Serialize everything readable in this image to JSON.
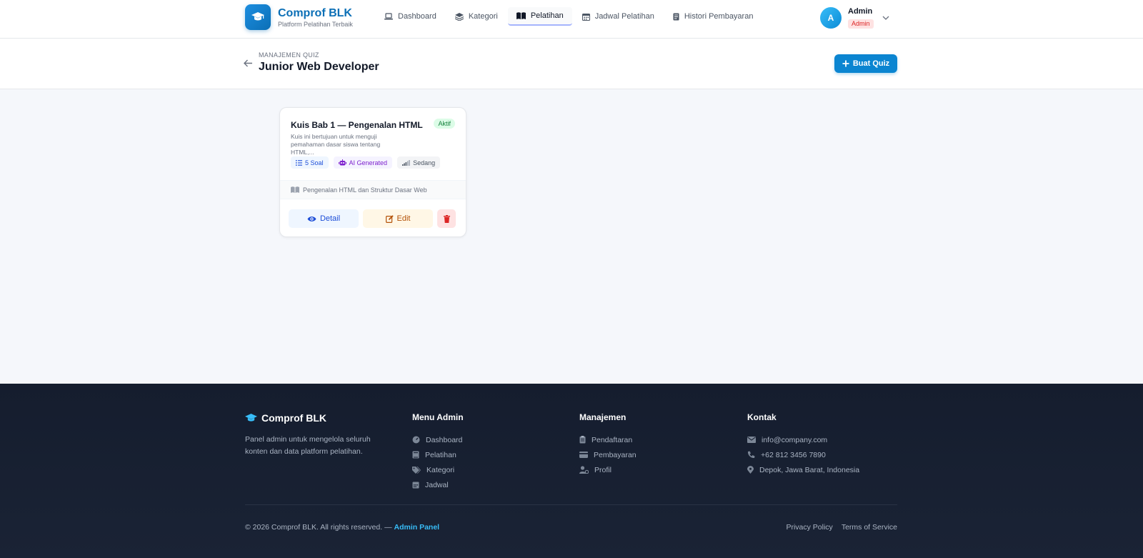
{
  "brand": {
    "title": "Comprof BLK",
    "subtitle": "Platform Pelatihan Terbaik",
    "color": "#0b6fb6"
  },
  "nav": {
    "items": [
      {
        "label": "Dashboard",
        "icon": "laptop-icon"
      },
      {
        "label": "Kategori",
        "icon": "layers-icon"
      },
      {
        "label": "Pelatihan",
        "icon": "book-open-icon",
        "active": true
      },
      {
        "label": "Jadwal Pelatihan",
        "icon": "calendar-icon"
      },
      {
        "label": "Histori Pembayaran",
        "icon": "receipt-icon"
      }
    ]
  },
  "user": {
    "initial": "A",
    "name": "Admin",
    "role": "Admin"
  },
  "header": {
    "breadcrumb": "MANAJEMEN QUIZ",
    "title": "Junior Web Developer",
    "create_button": "Buat Quiz"
  },
  "quiz_card": {
    "title": "Kuis Bab 1 — Pengenalan HTML",
    "status": "Aktif",
    "description": "Kuis ini bertujuan untuk menguji pemahaman dasar siswa tentang HTML,...",
    "question_count": "5 Soal",
    "generator": "AI Generated",
    "difficulty": "Sedang",
    "module": "Pengenalan HTML dan Struktur Dasar Web",
    "detail_button": "Detail",
    "edit_button": "Edit"
  },
  "footer": {
    "brand": "Comprof BLK",
    "about": "Panel admin untuk mengelola seluruh konten dan data platform pelatihan.",
    "menu_admin": {
      "heading": "Menu Admin",
      "items": [
        "Dashboard",
        "Pelatihan",
        "Kategori",
        "Jadwal"
      ]
    },
    "manajemen": {
      "heading": "Manajemen",
      "items": [
        "Pendaftaran",
        "Pembayaran",
        "Profil"
      ]
    },
    "kontak": {
      "heading": "Kontak",
      "email": "info@company.com",
      "phone": "+62 812 3456 7890",
      "address": "Depok, Jawa Barat, Indonesia"
    },
    "copyright": "© 2026 Comprof BLK. All rights reserved. —",
    "copyright_accent": "Admin Panel",
    "privacy": "Privacy Policy",
    "terms": "Terms of Service"
  }
}
